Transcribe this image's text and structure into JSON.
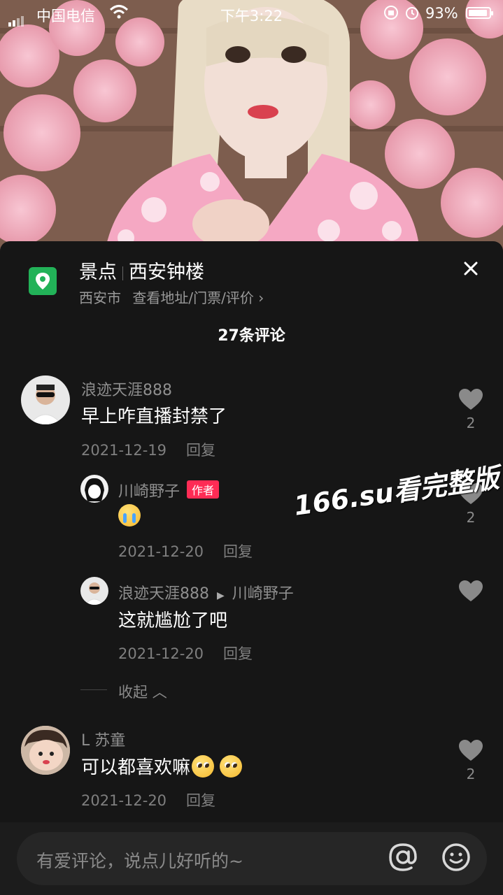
{
  "status_bar": {
    "carrier": "中国电信",
    "time": "下午3:22",
    "battery": "93%",
    "battery_level": 0.93
  },
  "location": {
    "category": "景点",
    "name": "西安钟楼",
    "city": "西安市",
    "link": "查看地址/门票/评价",
    "icon": "location-pin-icon"
  },
  "comment_count": "27条评论",
  "comments": [
    {
      "user": "浪迹天涯888",
      "text": "早上咋直播封禁了",
      "date": "2021-12-19",
      "reply_label": "回复",
      "likes": "2"
    },
    {
      "user": "川崎野子",
      "badge": "作者",
      "emoji": "crying-laughing-emoji",
      "date": "2021-12-20",
      "reply_label": "回复",
      "likes": "2"
    },
    {
      "user": "浪迹天涯888",
      "reply_to": "川崎野子",
      "text": "这就尴尬了吧",
      "date": "2021-12-20",
      "reply_label": "回复"
    },
    {
      "user": "L 苏童",
      "text": "可以都喜欢嘛",
      "emoji": "pleading-face-emoji",
      "date": "2021-12-20",
      "reply_label": "回复",
      "likes": "2"
    }
  ],
  "collapse_label": "收起",
  "watermark": "166.su看完整版",
  "input": {
    "placeholder": "有爱评论，说点儿好听的~"
  },
  "colors": {
    "background": "#161616",
    "author_badge": "#fe2c55",
    "location_icon": "#22b258"
  }
}
